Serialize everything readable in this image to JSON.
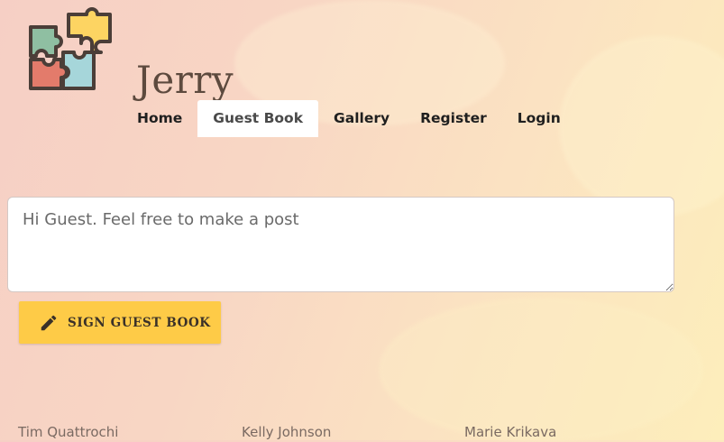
{
  "brand": {
    "name": "Jerry",
    "logo_icon": "puzzle-icon"
  },
  "nav": {
    "items": [
      {
        "label": "Home"
      },
      {
        "label": "Guest Book",
        "active": true
      },
      {
        "label": "Gallery"
      },
      {
        "label": "Register"
      },
      {
        "label": "Login"
      }
    ]
  },
  "guestbook": {
    "placeholder": "Hi Guest. Feel free to make a post",
    "value": "",
    "sign_button": {
      "label": "SIGN GUEST BOOK",
      "icon": "pencil-icon"
    }
  },
  "entries": [
    {
      "author": "Tim Quattrochi"
    },
    {
      "author": "Kelly Johnson"
    },
    {
      "author": "Marie Krikava"
    }
  ],
  "colors": {
    "accent": "#fecb47",
    "text_dark": "#1f1f1f",
    "brand_text": "#5d4a3e"
  }
}
